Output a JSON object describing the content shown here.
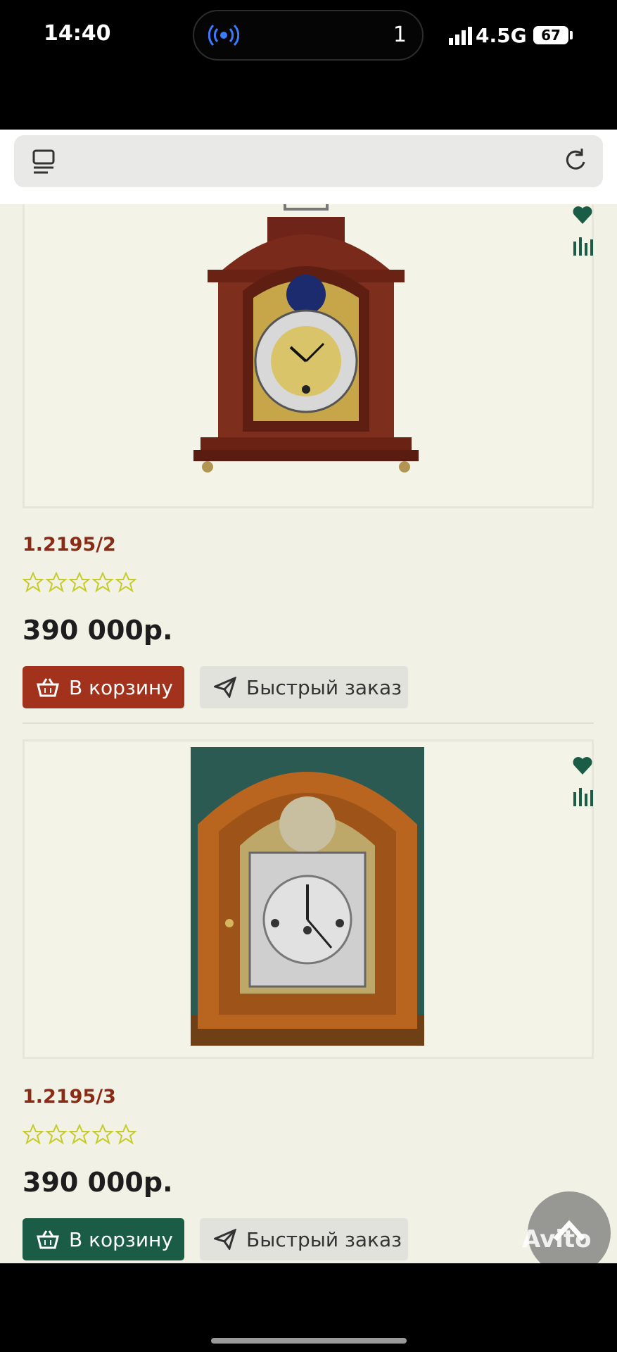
{
  "status_bar": {
    "time": "14:40",
    "island_count": "1",
    "network": "4.5G",
    "battery": "67"
  },
  "browser": {
    "tabs_icon": "tabs-icon",
    "reload_icon": "reload-icon"
  },
  "products": [
    {
      "sku": "1.2195/2",
      "price": "390 000р.",
      "rating": 0,
      "cart_label": "В корзину",
      "quick_label": "Быстрый заказ",
      "cart_color": "#a3321c"
    },
    {
      "sku": "1.2195/3",
      "price": "390 000р.",
      "rating": 0,
      "cart_label": "В корзину",
      "quick_label": "Быстрый заказ",
      "cart_color": "#1a5c45"
    }
  ],
  "colors": {
    "accent_green": "#1a5c45",
    "accent_red": "#a3321c",
    "sku_color": "#8a2b16",
    "star_color": "#c5cc2a"
  },
  "watermark": "Avito"
}
